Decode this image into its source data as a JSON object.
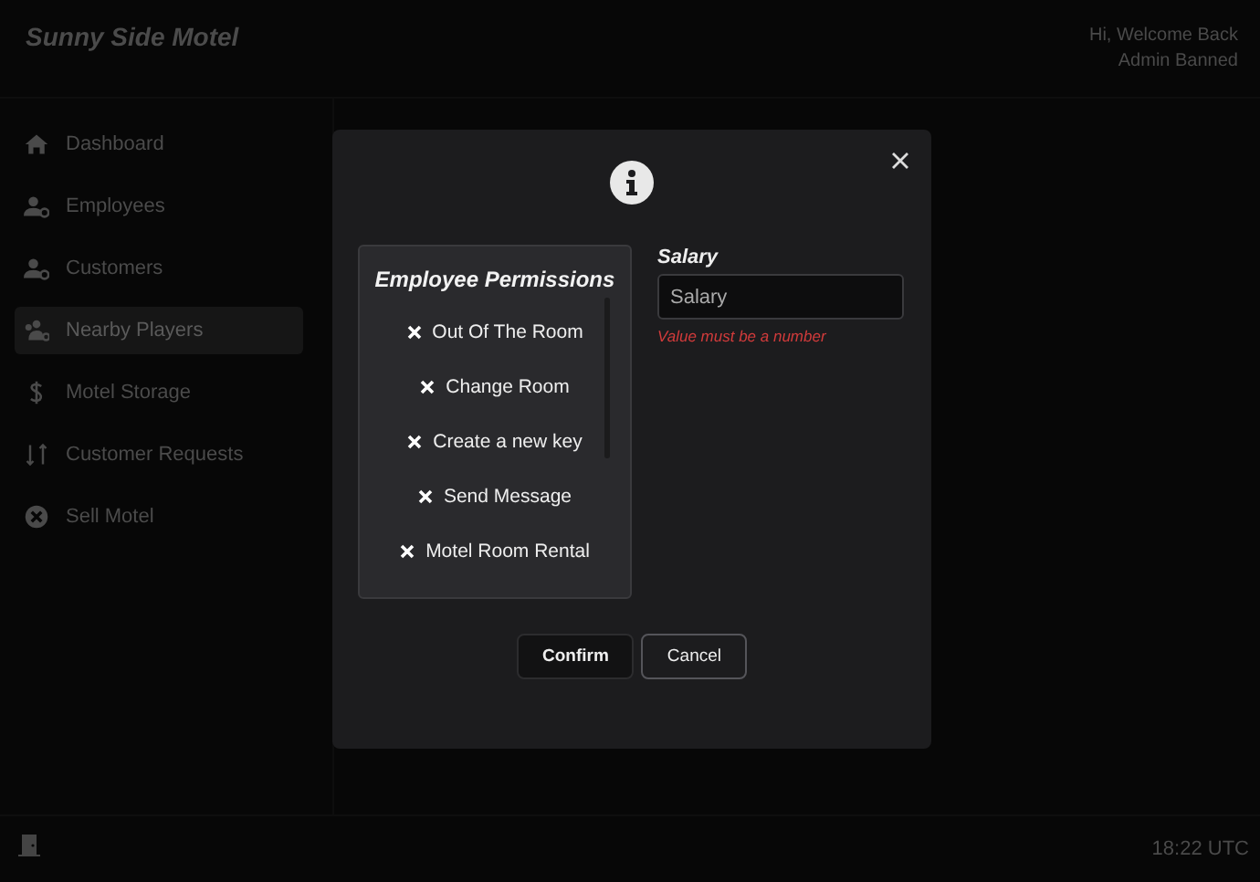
{
  "header": {
    "title": "Sunny Side Motel",
    "greeting": "Hi, Welcome Back",
    "user": "Admin Banned"
  },
  "sidebar": {
    "items": [
      {
        "label": "Dashboard",
        "selected": false
      },
      {
        "label": "Employees",
        "selected": false
      },
      {
        "label": "Customers",
        "selected": false
      },
      {
        "label": "Nearby Players",
        "selected": true
      },
      {
        "label": "Motel Storage",
        "selected": false
      },
      {
        "label": "Customer Requests",
        "selected": false
      },
      {
        "label": "Sell Motel",
        "selected": false
      }
    ]
  },
  "modal": {
    "permissions": {
      "title": "Employee Permissions",
      "items": [
        {
          "label": "Out Of The Room",
          "granted": false
        },
        {
          "label": "Change Room",
          "granted": false
        },
        {
          "label": "Create a new key",
          "granted": false
        },
        {
          "label": "Send Message",
          "granted": false
        },
        {
          "label": "Motel Room Rental",
          "granted": false
        }
      ]
    },
    "salary": {
      "label": "Salary",
      "placeholder": "Salary",
      "error": "Value must be a number"
    },
    "buttons": [
      {
        "label": "Confirm",
        "kind": "primary"
      },
      {
        "label": "Cancel",
        "kind": "secondary"
      }
    ]
  },
  "footer": {
    "time": "18:22 UTC"
  }
}
